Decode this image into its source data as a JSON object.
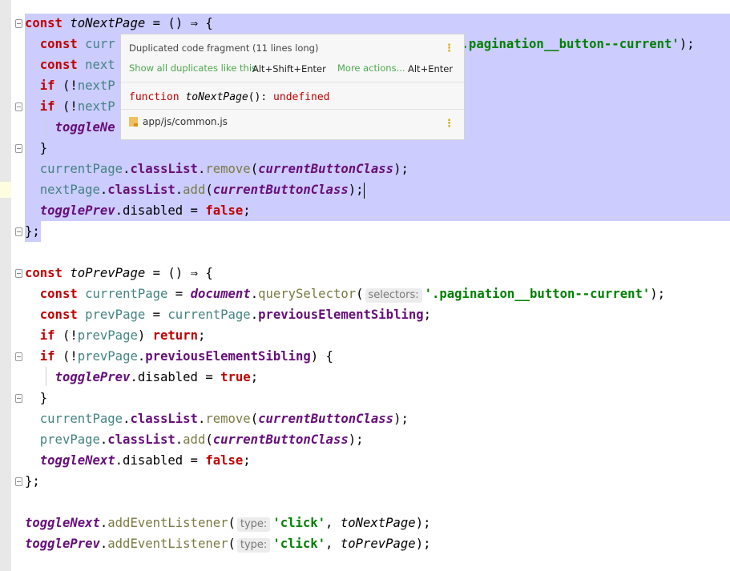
{
  "editor": {
    "code_lines": [
      {
        "id": "l1",
        "parts": [
          {
            "t": "const",
            "c": "red"
          },
          {
            "t": " "
          },
          {
            "t": "toNextPage",
            "c": "fn"
          },
          {
            "t": " = () ⇒ {"
          }
        ]
      },
      {
        "id": "l2",
        "parts": [
          {
            "t": "  "
          },
          {
            "t": "const",
            "c": "red"
          },
          {
            "t": " "
          },
          {
            "t": "curr",
            "c": "var"
          },
          {
            "t": "                                              "
          },
          {
            "t": ".pagination__button--current'",
            "c": "str"
          },
          {
            "t": ");"
          }
        ]
      },
      {
        "id": "l3",
        "parts": [
          {
            "t": "  "
          },
          {
            "t": "const",
            "c": "red"
          },
          {
            "t": " "
          },
          {
            "t": "next",
            "c": "var"
          }
        ]
      },
      {
        "id": "l4",
        "parts": [
          {
            "t": "  "
          },
          {
            "t": "if",
            "c": "red"
          },
          {
            "t": " (!"
          },
          {
            "t": "nextP",
            "c": "var"
          }
        ]
      },
      {
        "id": "l5",
        "parts": [
          {
            "t": "  "
          },
          {
            "t": "if",
            "c": "red"
          },
          {
            "t": " (!"
          },
          {
            "t": "nextP",
            "c": "var"
          }
        ]
      },
      {
        "id": "l6",
        "parts": [
          {
            "t": "    "
          },
          {
            "t": "toggleNe",
            "c": "gvar"
          }
        ]
      },
      {
        "id": "l7",
        "parts": [
          {
            "t": "  }"
          }
        ]
      },
      {
        "id": "l8",
        "parts": [
          {
            "t": "  "
          },
          {
            "t": "currentPage",
            "c": "var"
          },
          {
            "t": "."
          },
          {
            "t": "classList",
            "c": "prop"
          },
          {
            "t": "."
          },
          {
            "t": "remove",
            "c": "meth"
          },
          {
            "t": "("
          },
          {
            "t": "currentButtonClass",
            "c": "gvar"
          },
          {
            "t": ");"
          }
        ]
      },
      {
        "id": "l9",
        "parts": [
          {
            "t": "  "
          },
          {
            "t": "nextPage",
            "c": "var"
          },
          {
            "t": "."
          },
          {
            "t": "classList",
            "c": "prop"
          },
          {
            "t": "."
          },
          {
            "t": "add",
            "c": "meth"
          },
          {
            "t": "("
          },
          {
            "t": "currentButtonClass",
            "c": "gvar"
          },
          {
            "t": ");"
          },
          {
            "caret": true
          }
        ]
      },
      {
        "id": "l10",
        "parts": [
          {
            "t": "  "
          },
          {
            "t": "togglePrev",
            "c": "gvar"
          },
          {
            "t": ".disabled = "
          },
          {
            "t": "false",
            "c": "red"
          },
          {
            "t": ";"
          }
        ]
      },
      {
        "id": "l11",
        "parts": [
          {
            "t": "};"
          }
        ]
      },
      {
        "id": "l12",
        "parts": []
      },
      {
        "id": "l13",
        "parts": [
          {
            "t": "const",
            "c": "red"
          },
          {
            "t": " "
          },
          {
            "t": "toPrevPage",
            "c": "fn"
          },
          {
            "t": " = () ⇒ {"
          }
        ]
      },
      {
        "id": "l14",
        "parts": [
          {
            "t": "  "
          },
          {
            "t": "const",
            "c": "red"
          },
          {
            "t": " "
          },
          {
            "t": "currentPage",
            "c": "var"
          },
          {
            "t": " = "
          },
          {
            "t": "document",
            "c": "gvar"
          },
          {
            "t": "."
          },
          {
            "t": "querySelector",
            "c": "meth"
          },
          {
            "t": "("
          },
          {
            "hint": "selectors:"
          },
          {
            "t": "'.pagination__button--current'",
            "c": "str"
          },
          {
            "t": ");"
          }
        ]
      },
      {
        "id": "l15",
        "parts": [
          {
            "t": "  "
          },
          {
            "t": "const",
            "c": "red"
          },
          {
            "t": " "
          },
          {
            "t": "prevPage",
            "c": "var"
          },
          {
            "t": " = "
          },
          {
            "t": "currentPage",
            "c": "var"
          },
          {
            "t": "."
          },
          {
            "t": "previousElementSibling",
            "c": "prop"
          },
          {
            "t": ";"
          }
        ]
      },
      {
        "id": "l16",
        "parts": [
          {
            "t": "  "
          },
          {
            "t": "if",
            "c": "red"
          },
          {
            "t": " (!"
          },
          {
            "t": "prevPage",
            "c": "var"
          },
          {
            "t": ") "
          },
          {
            "t": "return",
            "c": "red"
          },
          {
            "t": ";"
          }
        ]
      },
      {
        "id": "l17",
        "parts": [
          {
            "t": "  "
          },
          {
            "t": "if",
            "c": "red"
          },
          {
            "t": " (!"
          },
          {
            "t": "prevPage",
            "c": "var"
          },
          {
            "t": "."
          },
          {
            "t": "previousElementSibling",
            "c": "prop"
          },
          {
            "t": ") {"
          }
        ]
      },
      {
        "id": "l18",
        "parts": [
          {
            "t": "    "
          },
          {
            "t": "togglePrev",
            "c": "gvar"
          },
          {
            "t": ".disabled = "
          },
          {
            "t": "true",
            "c": "red"
          },
          {
            "t": ";"
          }
        ]
      },
      {
        "id": "l19",
        "parts": [
          {
            "t": "  }"
          }
        ]
      },
      {
        "id": "l20",
        "parts": [
          {
            "t": "  "
          },
          {
            "t": "currentPage",
            "c": "var"
          },
          {
            "t": "."
          },
          {
            "t": "classList",
            "c": "prop"
          },
          {
            "t": "."
          },
          {
            "t": "remove",
            "c": "meth"
          },
          {
            "t": "("
          },
          {
            "t": "currentButtonClass",
            "c": "gvar"
          },
          {
            "t": ");"
          }
        ]
      },
      {
        "id": "l21",
        "parts": [
          {
            "t": "  "
          },
          {
            "t": "prevPage",
            "c": "var"
          },
          {
            "t": "."
          },
          {
            "t": "classList",
            "c": "prop"
          },
          {
            "t": "."
          },
          {
            "t": "add",
            "c": "meth"
          },
          {
            "t": "("
          },
          {
            "t": "currentButtonClass",
            "c": "gvar"
          },
          {
            "t": ");"
          }
        ]
      },
      {
        "id": "l22",
        "parts": [
          {
            "t": "  "
          },
          {
            "t": "toggleNext",
            "c": "gvar"
          },
          {
            "t": ".disabled = "
          },
          {
            "t": "false",
            "c": "red"
          },
          {
            "t": ";"
          }
        ]
      },
      {
        "id": "l23",
        "parts": [
          {
            "t": "};"
          }
        ]
      },
      {
        "id": "l24",
        "parts": []
      },
      {
        "id": "l25",
        "parts": [
          {
            "t": "toggleNext",
            "c": "gvar"
          },
          {
            "t": "."
          },
          {
            "t": "addEventListener",
            "c": "meth"
          },
          {
            "t": "("
          },
          {
            "hint": "type:"
          },
          {
            "t": "'click'",
            "c": "str"
          },
          {
            "t": ", "
          },
          {
            "t": "toNextPage",
            "c": "fn"
          },
          {
            "t": ");"
          }
        ]
      },
      {
        "id": "l26",
        "parts": [
          {
            "t": "togglePrev",
            "c": "gvar"
          },
          {
            "t": "."
          },
          {
            "t": "addEventListener",
            "c": "meth"
          },
          {
            "t": "("
          },
          {
            "hint": "type:"
          },
          {
            "t": "'click'",
            "c": "str"
          },
          {
            "t": ", "
          },
          {
            "t": "toPrevPage",
            "c": "fn"
          },
          {
            "t": ");"
          }
        ]
      }
    ]
  },
  "popup": {
    "title": "Duplicated code fragment (11 lines long)",
    "show_all_link": "Show all duplicates like this",
    "show_all_shortcut": "Alt+Shift+Enter",
    "more_actions_link": "More actions...",
    "more_actions_shortcut": "Alt+Enter",
    "signature_keyword": "function",
    "signature_name": "toNextPage",
    "signature_rest": "(): ",
    "signature_type": "undefined",
    "file_path": "app/js/common.js",
    "menu_icon": "vertical-ellipsis-icon",
    "file_icon": "js-file-icon"
  }
}
